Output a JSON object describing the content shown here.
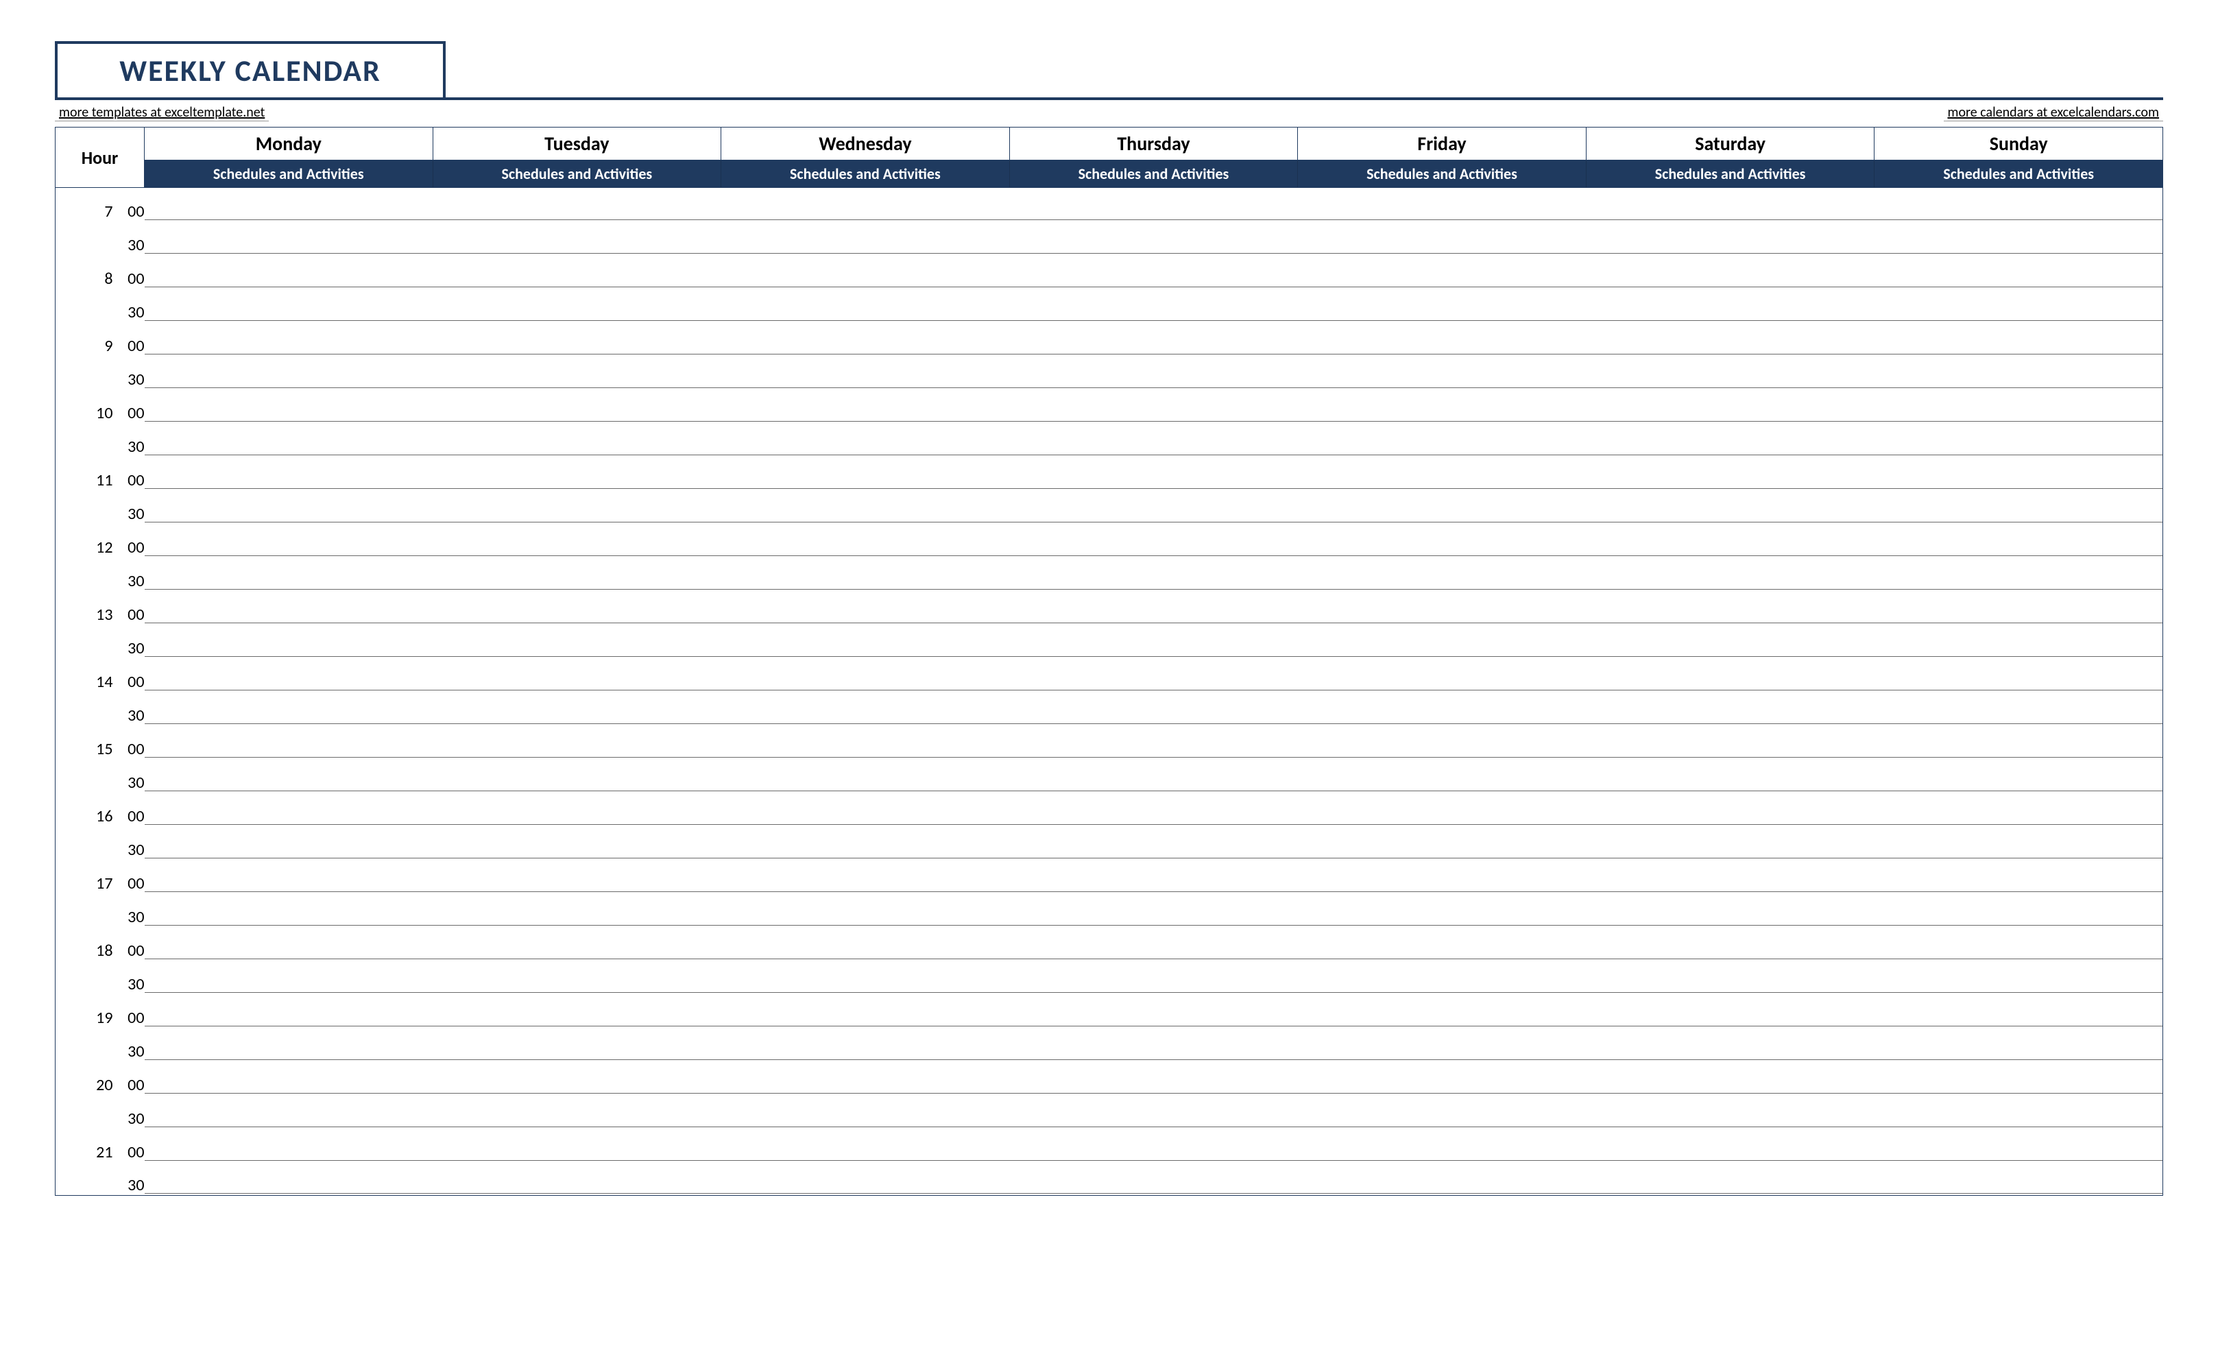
{
  "title": "WEEKLY CALENDAR",
  "links": {
    "left": "more templates at exceltemplate.net",
    "right": "more calendars at excelcalendars.com"
  },
  "header": {
    "hour_label": "Hour",
    "schedule_label": "Schedules and Activities"
  },
  "days": [
    "Monday",
    "Tuesday",
    "Wednesday",
    "Thursday",
    "Friday",
    "Saturday",
    "Sunday"
  ],
  "times": [
    {
      "hour": "7",
      "minute": "00"
    },
    {
      "hour": "",
      "minute": "30"
    },
    {
      "hour": "8",
      "minute": "00"
    },
    {
      "hour": "",
      "minute": "30"
    },
    {
      "hour": "9",
      "minute": "00"
    },
    {
      "hour": "",
      "minute": "30"
    },
    {
      "hour": "10",
      "minute": "00"
    },
    {
      "hour": "",
      "minute": "30"
    },
    {
      "hour": "11",
      "minute": "00"
    },
    {
      "hour": "",
      "minute": "30"
    },
    {
      "hour": "12",
      "minute": "00"
    },
    {
      "hour": "",
      "minute": "30"
    },
    {
      "hour": "13",
      "minute": "00"
    },
    {
      "hour": "",
      "minute": "30"
    },
    {
      "hour": "14",
      "minute": "00"
    },
    {
      "hour": "",
      "minute": "30"
    },
    {
      "hour": "15",
      "minute": "00"
    },
    {
      "hour": "",
      "minute": "30"
    },
    {
      "hour": "16",
      "minute": "00"
    },
    {
      "hour": "",
      "minute": "30"
    },
    {
      "hour": "17",
      "minute": "00"
    },
    {
      "hour": "",
      "minute": "30"
    },
    {
      "hour": "18",
      "minute": "00"
    },
    {
      "hour": "",
      "minute": "30"
    },
    {
      "hour": "19",
      "minute": "00"
    },
    {
      "hour": "",
      "minute": "30"
    },
    {
      "hour": "20",
      "minute": "00"
    },
    {
      "hour": "",
      "minute": "30"
    },
    {
      "hour": "21",
      "minute": "00"
    },
    {
      "hour": "",
      "minute": "30"
    }
  ]
}
